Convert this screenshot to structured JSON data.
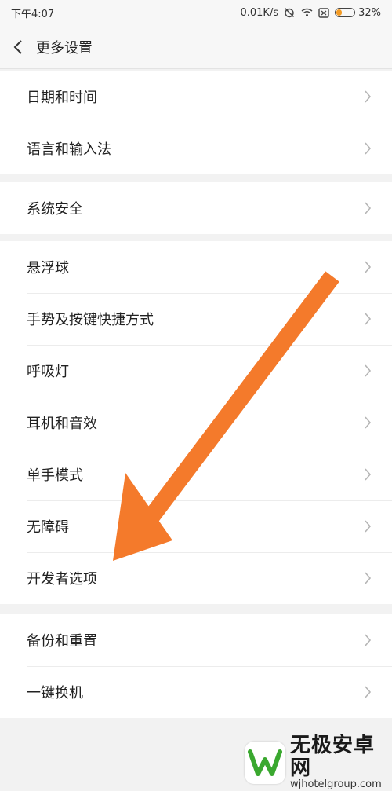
{
  "status_bar": {
    "time": "下午4:07",
    "net_speed": "0.01K/s",
    "battery_percent": "32%",
    "battery_level": 0.32
  },
  "header": {
    "title": "更多设置",
    "back_icon": "chevron-left-icon"
  },
  "groups": [
    {
      "items": [
        {
          "label": "日期和时间"
        },
        {
          "label": "语言和输入法"
        }
      ]
    },
    {
      "items": [
        {
          "label": "系统安全"
        }
      ]
    },
    {
      "items": [
        {
          "label": "悬浮球"
        },
        {
          "label": "手势及按键快捷方式"
        },
        {
          "label": "呼吸灯"
        },
        {
          "label": "耳机和音效"
        },
        {
          "label": "单手模式"
        },
        {
          "label": "无障碍"
        },
        {
          "label": "开发者选项"
        }
      ]
    },
    {
      "items": [
        {
          "label": "备份和重置"
        },
        {
          "label": "一键换机"
        }
      ]
    }
  ],
  "annotation": {
    "color": "#f47a2b"
  },
  "watermark": {
    "title": "无极安卓网",
    "subtitle": "wjhotelgroup.com",
    "logo_color": "#3aa82f"
  }
}
